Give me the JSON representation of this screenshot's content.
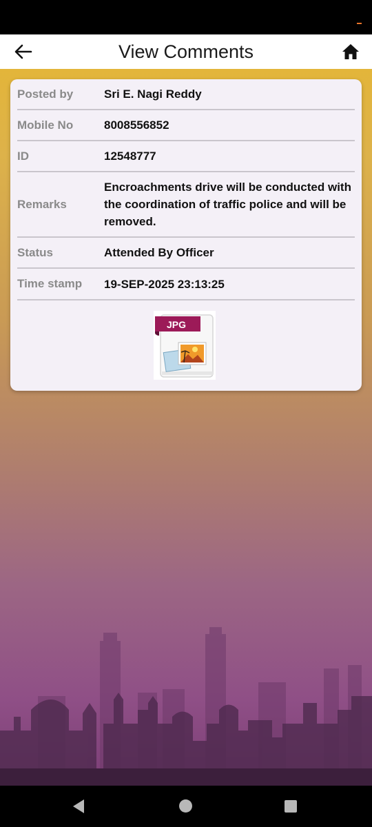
{
  "header": {
    "title": "View Comments",
    "back_icon": "arrow-left-icon",
    "home_icon": "home-icon"
  },
  "comment": {
    "rows": [
      {
        "label": "Posted by",
        "value": "Sri E. Nagi Reddy"
      },
      {
        "label": "Mobile No",
        "value": "8008556852"
      },
      {
        "label": "ID",
        "value": "12548777"
      },
      {
        "label": "Remarks",
        "value": "Encroachments drive will be conducted with the coordination of  traffic police and will be removed."
      },
      {
        "label": "Status",
        "value": "Attended By Officer"
      },
      {
        "label": "Time stamp",
        "value": "19-SEP-2025 23:13:25"
      }
    ],
    "attachment": {
      "type_label": "JPG",
      "icon": "jpg-file-icon"
    }
  },
  "colors": {
    "background_top": "#e3b53a",
    "background_bottom": "#7b3e76",
    "card": "#f4f0f7",
    "label_text": "#8a8a8a",
    "value_text": "#111111",
    "jpg_badge": "#9c1a58"
  },
  "system_nav": {
    "back_icon": "nav-back-triangle-icon",
    "home_icon": "nav-home-circle-icon",
    "recents_icon": "nav-recents-square-icon"
  }
}
